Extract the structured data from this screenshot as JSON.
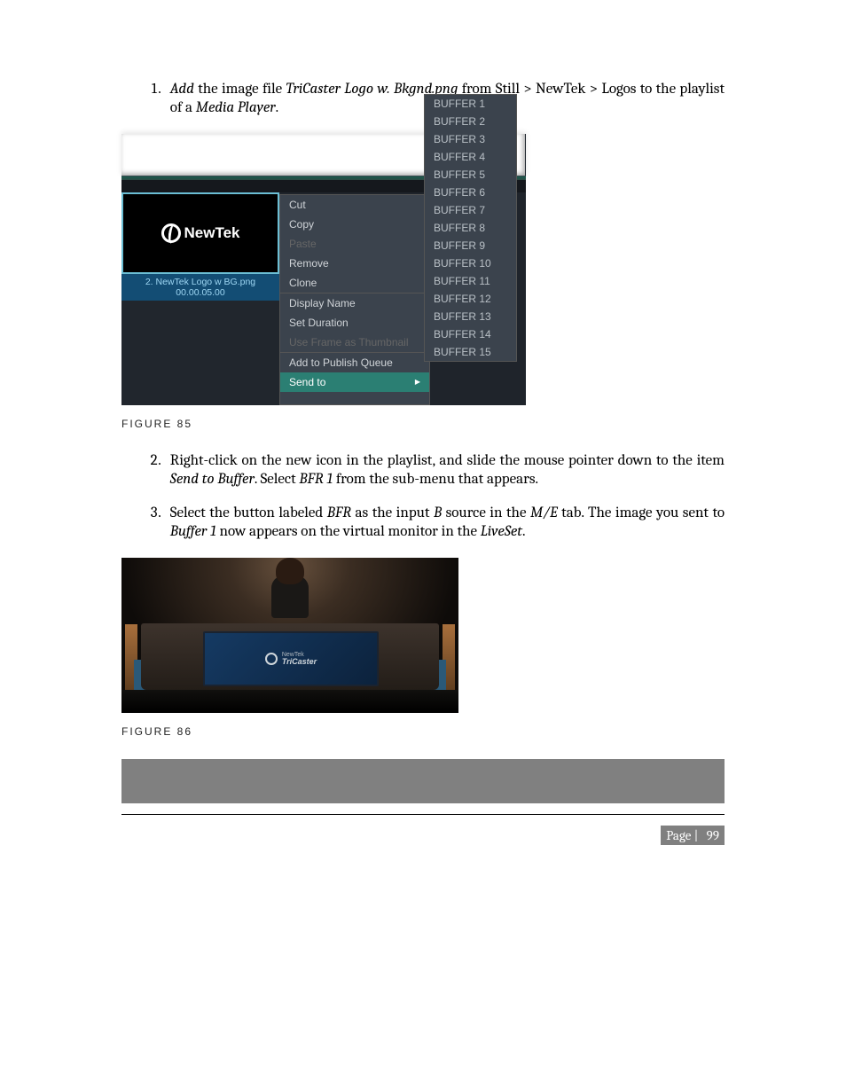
{
  "step1": {
    "num": "1.",
    "pre": "Add",
    "mid1": " the image file ",
    "file": "TriCaster Logo w. Bkgnd.png",
    "mid2": " from Still > NewTek > Logos to the playlist of a ",
    "mp": "Media Player",
    "end": "."
  },
  "fig85": {
    "logo_brand": "NewTek",
    "thumb_line1": "2. NewTek Logo w BG.png",
    "thumb_line2": "00.00.05.00",
    "menu": {
      "cut": "Cut",
      "copy": "Copy",
      "paste": "Paste",
      "remove": "Remove",
      "clone": "Clone",
      "display_name": "Display Name",
      "set_duration": "Set Duration",
      "use_frame": "Use Frame as Thumbnail",
      "add_publish": "Add to Publish Queue",
      "send_to": "Send to"
    },
    "submenu": [
      "BUFFER 1",
      "BUFFER 2",
      "BUFFER 3",
      "BUFFER 4",
      "BUFFER 5",
      "BUFFER 6",
      "BUFFER 7",
      "BUFFER 8",
      "BUFFER 9",
      "BUFFER 10",
      "BUFFER 11",
      "BUFFER 12",
      "BUFFER 13",
      "BUFFER 14",
      "BUFFER 15"
    ],
    "caption": "FIGURE 85"
  },
  "step2": {
    "num": "2.",
    "t1": "Right-click on the new icon in the playlist, and slide the mouse pointer down to the item ",
    "i1": "Send to Buffer",
    "t2": ".  Select ",
    "i2": "BFR 1",
    "t3": " from the sub-menu that appears."
  },
  "step3": {
    "num": "3.",
    "t1": "Select the button labeled ",
    "i1": "BFR",
    "t2": " as the input ",
    "i2": "B",
    "t3": " source in the ",
    "i3": "M/E",
    "t4": " tab. The image you sent to ",
    "i4": "Buffer 1",
    "t5": " now appears on the virtual monitor in the ",
    "i5": "LiveSet",
    "t6": "."
  },
  "fig86": {
    "logo_top": "NewTek",
    "logo_bottom": "TriCaster",
    "caption": "FIGURE 86"
  },
  "footer": {
    "label": "Page | ",
    "num": "99"
  }
}
